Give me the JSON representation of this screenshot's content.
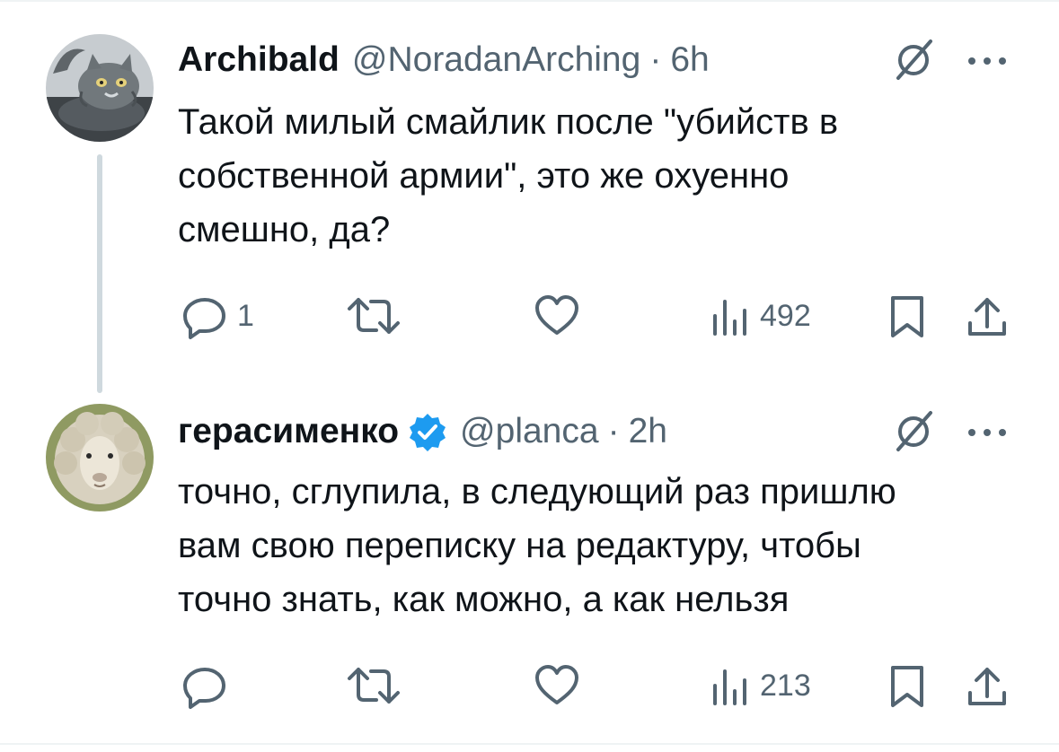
{
  "tweets": [
    {
      "author_name": "Archibald",
      "handle": "@NoradanArching",
      "separator": "·",
      "time": "6h",
      "verified": false,
      "avatar": "cat-avatar",
      "text_lines": [
        "Такой милый смайлик после \"убийств в",
        "собственной армии\", это же охуенно",
        "смешно, да?"
      ],
      "reply_count": "1",
      "retweet_count": "",
      "like_count": "",
      "view_count": "492"
    },
    {
      "author_name": "герасименко",
      "handle": "@planca",
      "separator": "·",
      "time": "2h",
      "verified": true,
      "avatar": "sheep-avatar",
      "text_lines": [
        "точно, сглупила, в следующий раз пришлю",
        "вам свою переписку на редактуру, чтобы",
        "точно знать, как можно, а как нельзя"
      ],
      "reply_count": "",
      "retweet_count": "",
      "like_count": "",
      "view_count": "213"
    }
  ],
  "icons": {
    "reply": "reply-icon",
    "retweet": "retweet-icon",
    "like": "heart-icon",
    "views": "views-icon",
    "bookmark": "bookmark-icon",
    "share": "share-icon",
    "grok": "grok-icon",
    "more": "more-icon",
    "verified": "verified-badge-icon"
  },
  "colors": {
    "text": "#0f1419",
    "secondary": "#536471",
    "thread_line": "#cfd9de",
    "verified_blue": "#1d9bf0"
  }
}
